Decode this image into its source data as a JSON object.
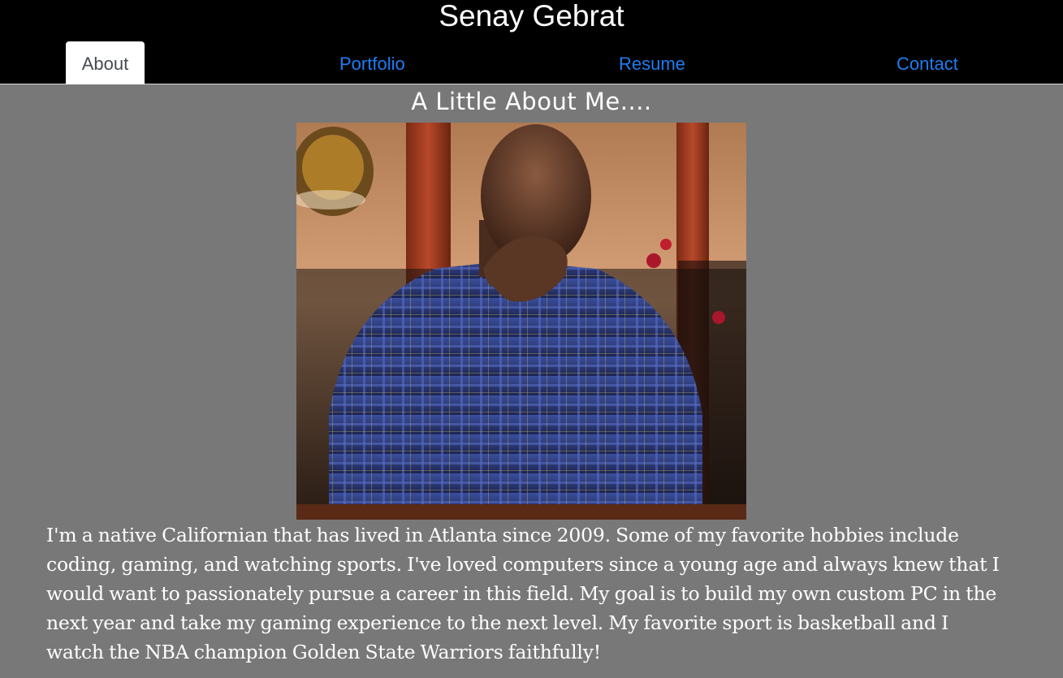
{
  "header": {
    "title": "Senay Gebrat"
  },
  "nav": {
    "tabs": [
      {
        "label": "About",
        "active": true
      },
      {
        "label": "Portfolio",
        "active": false
      },
      {
        "label": "Resume",
        "active": false
      },
      {
        "label": "Contact",
        "active": false
      }
    ]
  },
  "about": {
    "heading": "A Little About Me....",
    "photo": "profile-photo",
    "bio": "I'm a native Californian that has lived in Atlanta since 2009. Some of my favorite hobbies include coding, gaming, and watching sports. I've loved computers since a young age and always knew that I would want to passionately pursue a career in this field. My goal is to build my own custom PC in the next year and take my gaming experience to the next level. My favorite sport is basketball and I watch the NBA champion Golden State Warriors faithfully!"
  },
  "colors": {
    "header_bg": "#000000",
    "page_bg": "#787878",
    "link": "#1e7df2",
    "active_tab_bg": "#ffffff"
  }
}
